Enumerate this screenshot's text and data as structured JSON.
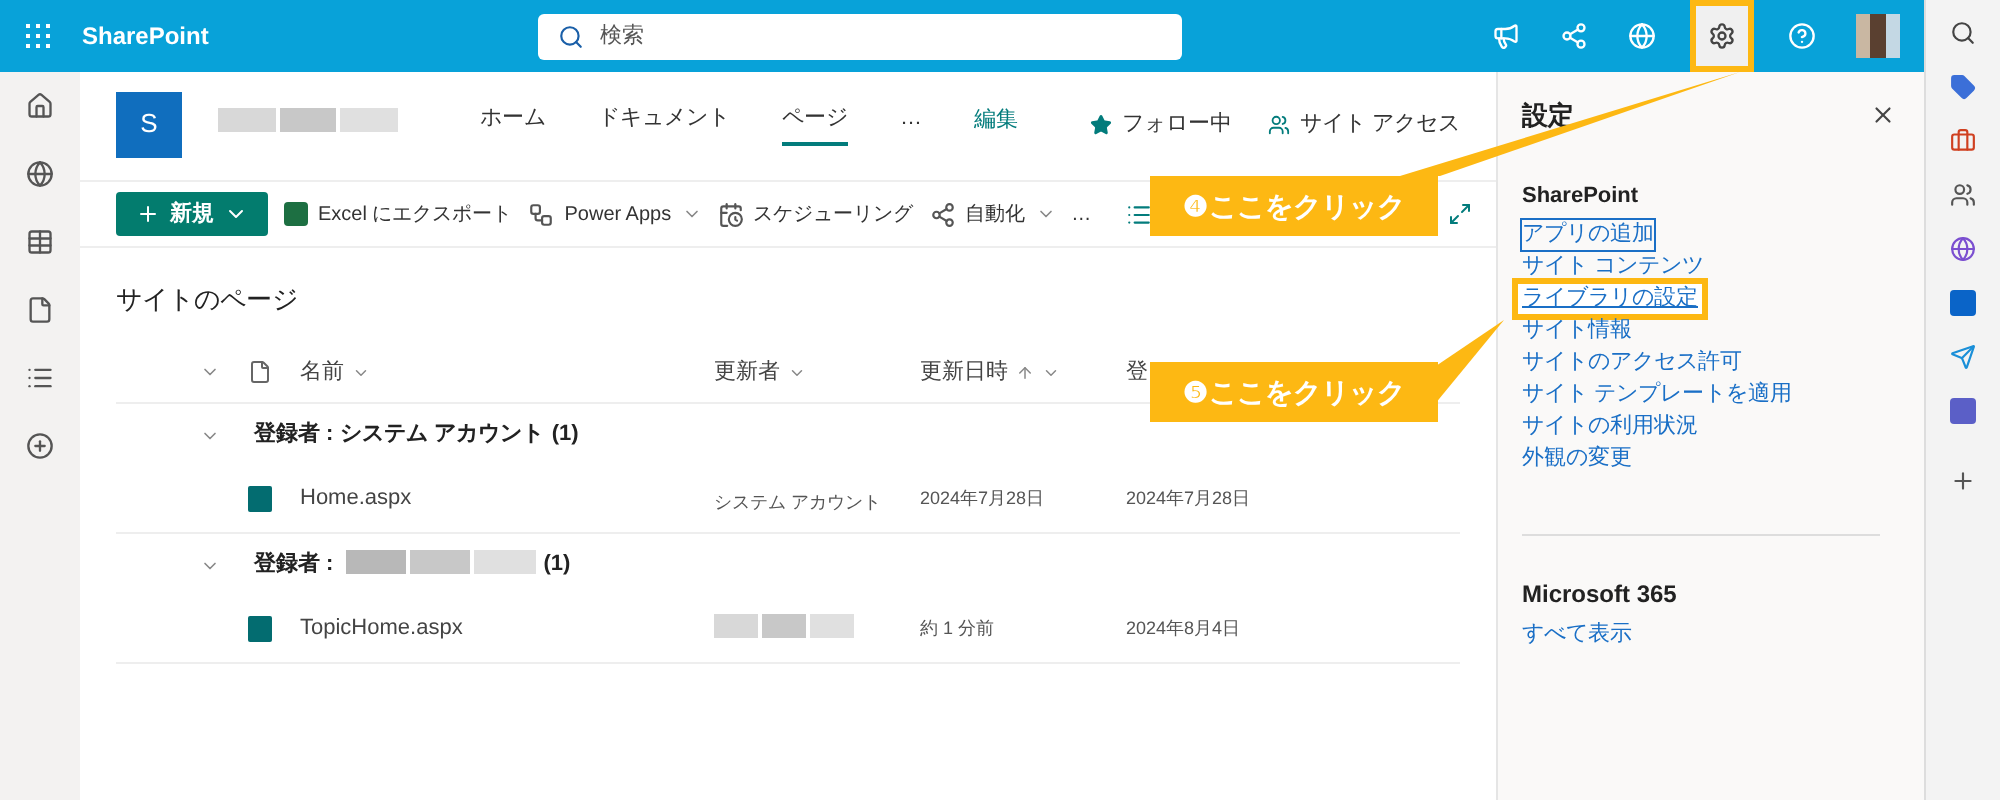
{
  "topbar": {
    "app_name": "SharePoint",
    "search": {
      "placeholder": "検索"
    }
  },
  "site": {
    "logo_letter": "S",
    "nav": [
      {
        "label": "ホーム",
        "selected": false
      },
      {
        "label": "ドキュメント",
        "selected": false
      },
      {
        "label": "ページ",
        "selected": true
      },
      {
        "label": "…",
        "selected": false
      }
    ],
    "edit_link": "編集",
    "follow": "フォロー中",
    "site_access": "サイト アクセス"
  },
  "toolbar": {
    "new_button": "新規",
    "items": [
      {
        "label": "Excel にエクスポート",
        "kind": "excel",
        "dropdown": false
      },
      {
        "label": "Power Apps",
        "kind": "powerapps",
        "dropdown": true
      },
      {
        "label": "スケジューリング",
        "kind": "schedule",
        "dropdown": false
      },
      {
        "label": "自動化",
        "kind": "automate",
        "dropdown": true
      },
      {
        "label": "…",
        "kind": "more",
        "dropdown": false
      }
    ]
  },
  "list": {
    "title": "サイトのページ",
    "columns": [
      {
        "label": "名前",
        "sorted": false,
        "dropdown": true
      },
      {
        "label": "更新者",
        "sorted": false,
        "dropdown": true
      },
      {
        "label": "更新日時",
        "sorted": true,
        "dropdown": true
      },
      {
        "label": "登",
        "sorted": false,
        "dropdown": false
      }
    ],
    "groups": [
      {
        "label": "登録者 : システム アカウント",
        "count": "(1)",
        "redacted": false,
        "rows": [
          {
            "name": "Home.aspx",
            "modified_by": "システム アカウント",
            "modified": "2024年7月28日",
            "created": "2024年7月28日"
          }
        ]
      },
      {
        "label": "登録者 :",
        "count": "(1)",
        "redacted": true,
        "rows": [
          {
            "name": "TopicHome.aspx",
            "modified_by": "",
            "modified": "約 1 分前",
            "created": "2024年8月4日"
          }
        ]
      }
    ]
  },
  "settings_panel": {
    "title": "設定",
    "sections": [
      {
        "heading": "SharePoint",
        "links": [
          {
            "label": "アプリの追加",
            "focused": true
          },
          {
            "label": "サイト コンテンツ",
            "focused": false
          },
          {
            "label": "ライブラリの設定",
            "focused": false
          },
          {
            "label": "サイト情報",
            "focused": false
          },
          {
            "label": "サイトのアクセス許可",
            "focused": false
          },
          {
            "label": "サイト テンプレートを適用",
            "focused": false
          },
          {
            "label": "サイトの利用状況",
            "focused": false
          },
          {
            "label": "外観の変更",
            "focused": false
          }
        ]
      },
      {
        "heading": "Microsoft 365",
        "links": [
          {
            "label": "すべて表示",
            "focused": false
          }
        ]
      }
    ]
  },
  "callouts": {
    "settings_button": "❹ここをクリック",
    "library_settings": "❺ここをクリック"
  }
}
